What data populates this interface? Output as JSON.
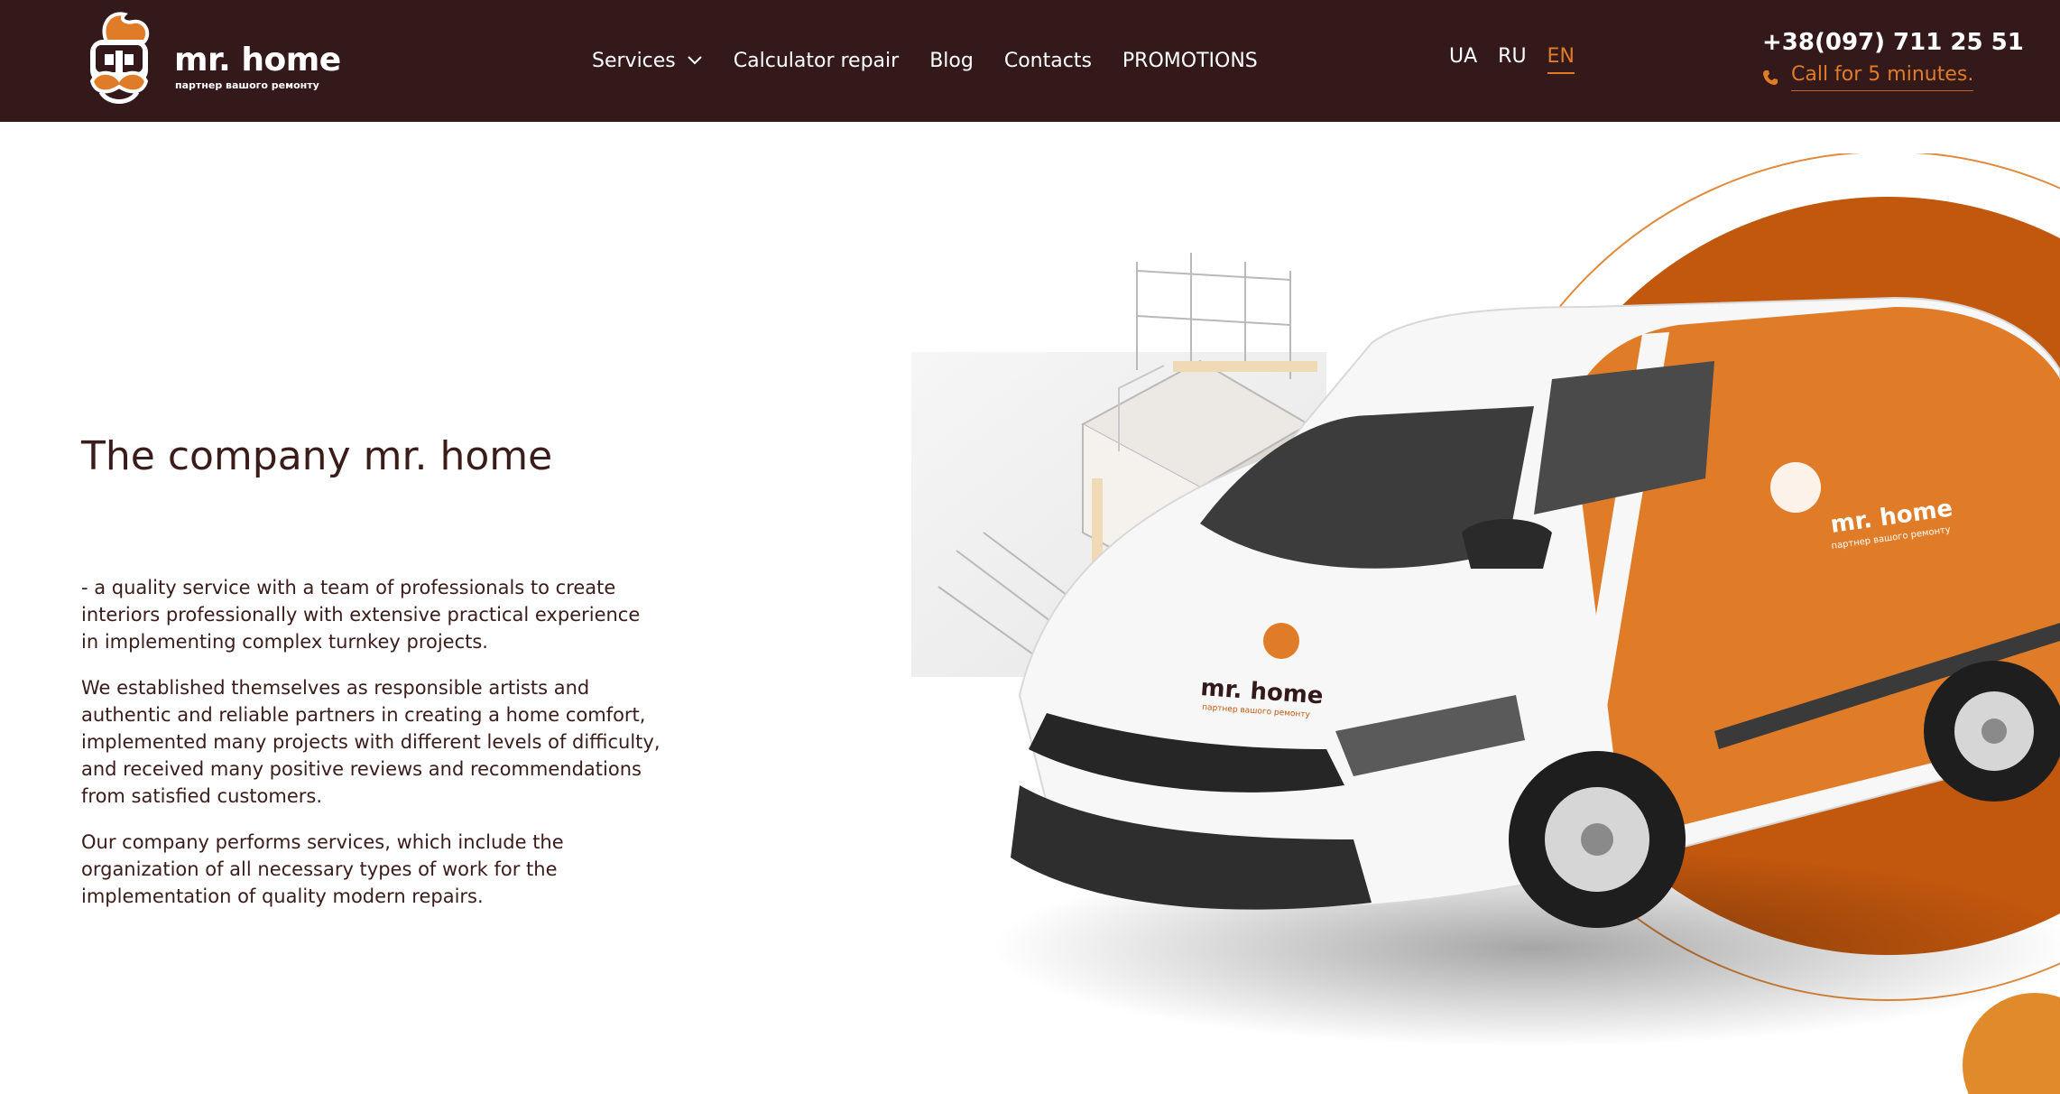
{
  "header": {
    "logo": {
      "title": "mr. home",
      "subtitle": "партнер вашого ремонту"
    },
    "nav": [
      {
        "label": "Services",
        "has_dropdown": true
      },
      {
        "label": "Calculator repair"
      },
      {
        "label": "Blog"
      },
      {
        "label": "Contacts"
      },
      {
        "label": "PROMOTIONS"
      }
    ],
    "languages": [
      {
        "code": "UA",
        "active": false
      },
      {
        "code": "RU",
        "active": false
      },
      {
        "code": "EN",
        "active": true
      }
    ],
    "phone": "+38(097) 711 25 51",
    "callback": "Call for 5 minutes."
  },
  "main": {
    "title": "The company mr. home",
    "paragraphs": [
      "- a quality service with a team of professionals to create interiors professionally with extensive practical experience in implementing complex turnkey projects.",
      "We established themselves as responsible artists and authentic and reliable partners in creating a home comfort, implemented many projects with different levels of difficulty, and received many positive reviews and recommendations from satisfied customers.",
      "Our company performs services, which include the organization of all necessary types of work for the implementation of quality modern repairs."
    ]
  },
  "hero": {
    "van_brand": "mr. home",
    "van_slogan": "партнер вашого ремонту"
  },
  "colors": {
    "header_bg": "#33191a",
    "accent": "#e07b28",
    "text": "#3a1c1a"
  },
  "icons": [
    "mascot-logo-icon",
    "chevron-down-icon",
    "phone-icon"
  ]
}
